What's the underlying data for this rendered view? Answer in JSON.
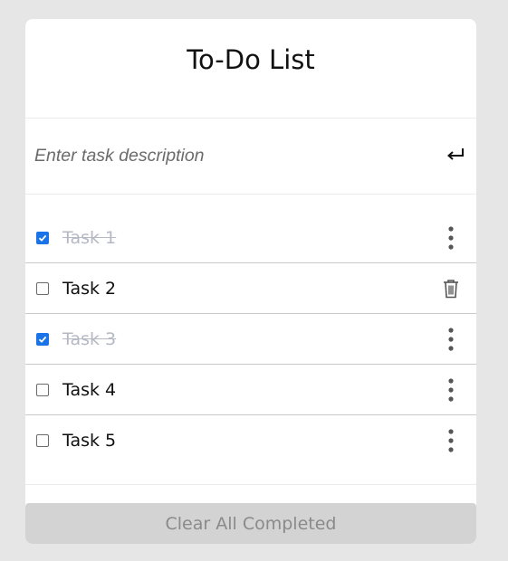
{
  "app": {
    "title": "To-Do List"
  },
  "input": {
    "placeholder": "Enter task description",
    "value": ""
  },
  "tasks": [
    {
      "label": "Task 1",
      "completed": true,
      "action": "menu"
    },
    {
      "label": "Task 2",
      "completed": false,
      "action": "delete"
    },
    {
      "label": "Task 3",
      "completed": true,
      "action": "menu"
    },
    {
      "label": "Task 4",
      "completed": false,
      "action": "menu"
    },
    {
      "label": "Task 5",
      "completed": false,
      "action": "menu"
    }
  ],
  "footer": {
    "clear_label": "Clear All Completed"
  },
  "icons": {
    "enter": "enter-arrow-icon",
    "menu": "vertical-dots-icon",
    "delete": "trash-icon",
    "check": "checkmark-icon"
  },
  "colors": {
    "background": "#e6e6e6",
    "card": "#ffffff",
    "checked": "#1a73e8",
    "completed_text": "#b5b9c5",
    "clear_button_bg": "#d3d3d3"
  }
}
